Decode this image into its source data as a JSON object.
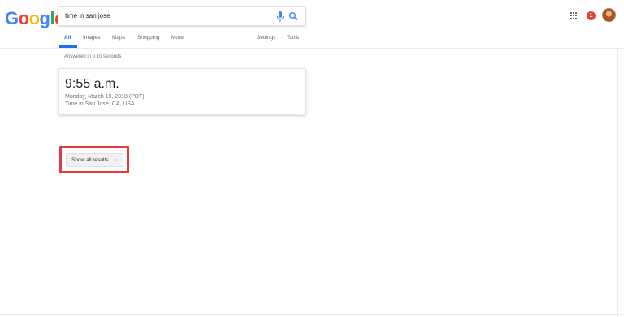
{
  "brand": {
    "letters": [
      "G",
      "o",
      "o",
      "g",
      "l",
      "e"
    ],
    "colors": [
      "#4285f4",
      "#ea4335",
      "#fbbc05",
      "#4285f4",
      "#34a853",
      "#ea4335"
    ]
  },
  "search": {
    "query": "time in san jose"
  },
  "header": {
    "notification_count": "1"
  },
  "tabs": [
    {
      "label": "All",
      "active": true
    },
    {
      "label": "Images",
      "active": false
    },
    {
      "label": "Maps",
      "active": false
    },
    {
      "label": "Shopping",
      "active": false
    },
    {
      "label": "More",
      "active": false
    },
    {
      "label": "Settings",
      "active": false
    },
    {
      "label": "Tools",
      "active": false
    }
  ],
  "stats": {
    "text": "Answered in 0.10 seconds"
  },
  "time_card": {
    "time": "9:55 a.m.",
    "date": "Monday, March 19, 2018 (PDT)",
    "place": "Time in San Jose, CA, USA"
  },
  "actions": {
    "show_all": "Show all results",
    "chevron": "›"
  },
  "colors": {
    "accent": "#1a73e8",
    "highlight": "#e23b3b",
    "notification": "#db4437"
  },
  "icons": [
    "mic-icon",
    "search-icon",
    "apps-grid-icon",
    "chevron-right-icon"
  ]
}
